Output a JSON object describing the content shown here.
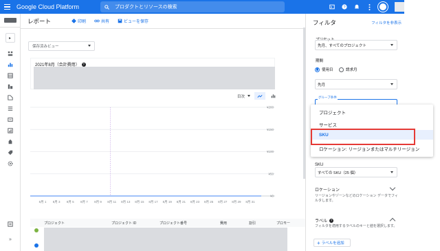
{
  "topbar": {
    "brand": "Google Cloud Platform",
    "search_placeholder": "プロダクトとリソースの検索"
  },
  "report": {
    "title": "レポート",
    "print_label": "印刷",
    "share_label": "共有",
    "save_view_label": "ビューを保存",
    "saved_view_placeholder": "保存済みビュー",
    "card_title": "2021年8月（合計費用）"
  },
  "chart_controls": {
    "granularity": "日次"
  },
  "chart_data": {
    "type": "line",
    "x": [
      "8月 1",
      "8月 3",
      "8月 5",
      "8月 7",
      "8月 9",
      "8月 11",
      "8月 13",
      "8月 15",
      "8月 17",
      "8月 19",
      "8月 21",
      "8月 23",
      "8月 25",
      "8月 27",
      "8月 29",
      "8月 31"
    ],
    "y_ticks": [
      "¥200",
      "¥150",
      "¥100",
      "¥50",
      "¥0"
    ],
    "title": "",
    "xlabel": "",
    "ylabel": "",
    "ylim": [
      0,
      200
    ],
    "grid": true
  },
  "table": {
    "columns": [
      "プロジェクト",
      "プロジェクト ID",
      "プロジェクト番号",
      "費用",
      "割引",
      "プロモー"
    ]
  },
  "filter": {
    "title": "フィルタ",
    "hide_label": "フィルタを非表示",
    "preset_label": "プリセット",
    "preset_value": "先月、すべてのプロジェクト",
    "period_label": "期間",
    "usage_date": "使用日",
    "invoice_month": "請求月",
    "period_value": "先月",
    "group_by_label": "グループ条件",
    "dropdown": [
      "プロジェクト",
      "サービス",
      "SKU",
      "ロケーション: リージョンまたはマルチリージョン"
    ],
    "sku_label": "SKU",
    "sku_value": "すべての SKU（25 個）",
    "location_title": "ロケーション",
    "location_desc": "リージョンやゾーンなどのロケーション データでフィルタします。",
    "labels_title": "ラベル",
    "labels_desc": "フィルタを適用するラベルのキーと値を選択します。",
    "add_label": "ラベルを追加"
  },
  "colors": {
    "accent": "#1a73e8",
    "highlight": "#e53935"
  }
}
